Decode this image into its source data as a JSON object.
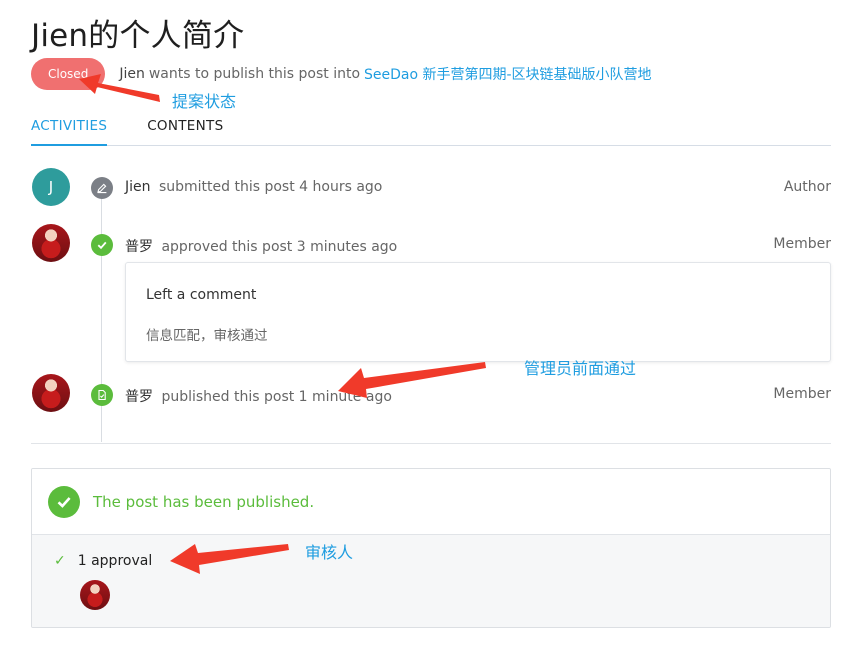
{
  "page": {
    "title": "Jien的个人简介"
  },
  "meta": {
    "status": "Closed",
    "author": "Jien",
    "middle_text": "wants to publish this post into",
    "target_link": "SeeDao 新手营第四期-区块链基础版小队营地"
  },
  "tabs": [
    {
      "label": "ACTIVITIES",
      "active": true
    },
    {
      "label": "CONTENTS",
      "active": false
    }
  ],
  "timeline": [
    {
      "avatar_letter": "J",
      "user": "Jien",
      "action": "submitted this post 4 hours ago",
      "role": "Author",
      "icon": "pencil-icon"
    },
    {
      "user": "普罗",
      "action": "approved this post 3 minutes ago",
      "role": "Member",
      "icon": "check-icon"
    },
    {
      "user": "普罗",
      "action": "published this post 1 minute ago",
      "role": "Member",
      "icon": "document-icon"
    }
  ],
  "comment": {
    "title": "Left a comment",
    "body": "信息匹配，审核通过"
  },
  "result": {
    "message": "The post has been published.",
    "approval_count": "1 approval"
  },
  "annotations": {
    "status_label": "提案状态",
    "admin_label": "管理员前面通过",
    "reviewer_label": "审核人"
  },
  "colors": {
    "accent": "#1f9de0",
    "status_closed": "#f07070",
    "success": "#5bbc3c",
    "arrow": "#f03a2a"
  }
}
